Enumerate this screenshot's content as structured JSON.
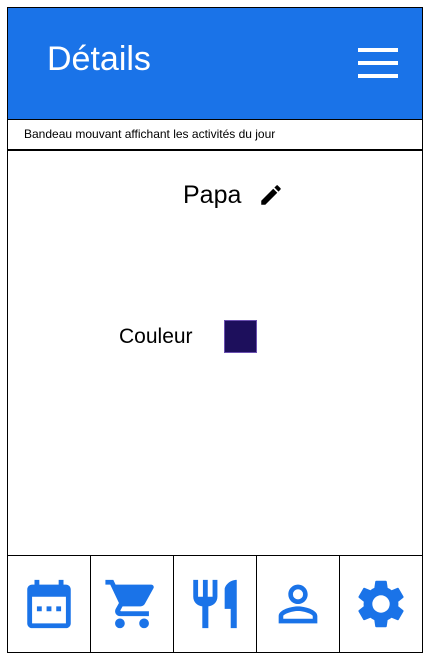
{
  "header": {
    "title": "Détails"
  },
  "ticker": {
    "text": "Bandeau mouvant affichant les activités du jour"
  },
  "profile": {
    "name": "Papa",
    "color_label": "Couleur",
    "color_value": "#1d0f5c"
  },
  "colors": {
    "accent": "#1a73e8"
  },
  "nav": {
    "items": [
      "calendar-icon",
      "cart-icon",
      "restaurant-icon",
      "person-icon",
      "settings-icon"
    ]
  }
}
